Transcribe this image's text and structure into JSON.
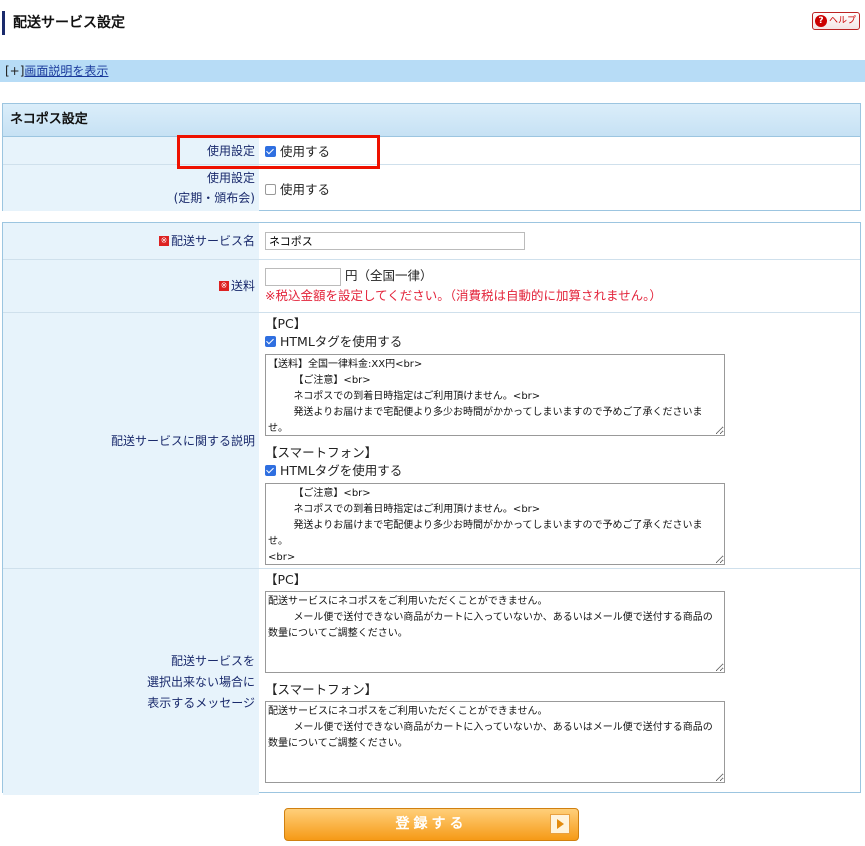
{
  "header": {
    "title": "配送サービス設定",
    "help_label": "ヘルプ",
    "help_icon": "question-icon"
  },
  "desc_bar": {
    "toggle": "[+]",
    "link": "画面説明を表示"
  },
  "usage_section": {
    "title": "ネコポス設定",
    "rows": [
      {
        "label": "使用設定",
        "checkbox_label": "使用する",
        "checked": true
      },
      {
        "label": "使用設定",
        "sublabel": "(定期・頒布会)",
        "checkbox_label": "使用する",
        "checked": false
      }
    ]
  },
  "service": {
    "name_label": "配送サービス名",
    "name_value": "ネコポス",
    "fee_label": "送料",
    "fee_value": "",
    "fee_unit": "円（全国一律）",
    "fee_note": "※税込金額を設定してください。（消費税は自動的に加算されません。）",
    "desc_label": "配送サービスに関する説明",
    "pc_label": "【PC】",
    "sp_label": "【スマートフォン】",
    "html_tag_label": "HTMLタグを使用する",
    "pc_desc_text": "【送料】全国一律料金:XX円<br>\n        【ご注意】<br>\n        ネコポスでの到着日時指定はご利用頂けません。<br>\n        発送よりお届けまで宅配便より多少お時間がかかってしまいますので予めご了承くださいませ。\n<br>",
    "sp_desc_text": "        【ご注意】<br>\n        ネコポスでの到着日時指定はご利用頂けません。<br>\n        発送よりお届けまで宅配便より多少お時間がかかってしまいますので予めご了承くださいませ。\n<br>\n        またお支払い方法選択時、代金引換はご利用頂けません。",
    "msg_label_lines": [
      "配送サービスを",
      "選択出来ない場合に",
      "表示するメッセージ"
    ],
    "pc_msg_text": "配送サービスにネコポスをご利用いただくことができません。\n        メール便で送付できない商品がカートに入っていないか、あるいはメール便で送付する商品の\n数量についてご調整ください。",
    "sp_msg_text": "配送サービスにネコポスをご利用いただくことができません。\n        メール便で送付できない商品がカートに入っていないか、あるいはメール便で送付する商品の\n数量についてご調整ください。",
    "required_mark": "※"
  },
  "submit_label": "登録する",
  "colors": {
    "highlight": "#ee1100",
    "accent": "#f69a16",
    "checkbox": "#2f6fe0"
  }
}
